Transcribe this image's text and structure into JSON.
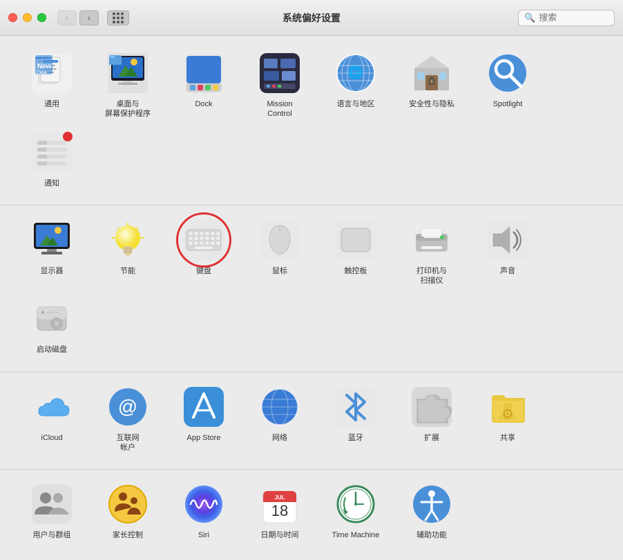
{
  "titlebar": {
    "title": "系统偏好设置",
    "search_placeholder": "搜索"
  },
  "sections": [
    {
      "id": "section1",
      "items": [
        {
          "id": "general",
          "label": "通用",
          "icon": "general"
        },
        {
          "id": "desktop",
          "label": "桌面与\n屏幕保护程序",
          "icon": "desktop"
        },
        {
          "id": "dock",
          "label": "Dock",
          "icon": "dock"
        },
        {
          "id": "mission-control",
          "label": "Mission\nControl",
          "icon": "mission"
        },
        {
          "id": "language",
          "label": "语言与地区",
          "icon": "language"
        },
        {
          "id": "security",
          "label": "安全性与隐私",
          "icon": "security"
        },
        {
          "id": "spotlight",
          "label": "Spotlight",
          "icon": "spotlight"
        },
        {
          "id": "notification",
          "label": "通知",
          "icon": "notification",
          "badge": true
        }
      ]
    },
    {
      "id": "section2",
      "items": [
        {
          "id": "display",
          "label": "显示器",
          "icon": "display"
        },
        {
          "id": "energy",
          "label": "节能",
          "icon": "energy"
        },
        {
          "id": "keyboard",
          "label": "键盘",
          "icon": "keyboard",
          "highlighted": true
        },
        {
          "id": "mouse",
          "label": "鼠标",
          "icon": "mouse"
        },
        {
          "id": "trackpad",
          "label": "触控板",
          "icon": "trackpad"
        },
        {
          "id": "printer",
          "label": "打印机与\n扫描仪",
          "icon": "printer"
        },
        {
          "id": "sound",
          "label": "声音",
          "icon": "sound"
        },
        {
          "id": "startup",
          "label": "启动磁盘",
          "icon": "startup"
        }
      ]
    },
    {
      "id": "section3",
      "items": [
        {
          "id": "icloud",
          "label": "iCloud",
          "icon": "icloud"
        },
        {
          "id": "internet",
          "label": "互联网\n帐户",
          "icon": "internet"
        },
        {
          "id": "appstore",
          "label": "App Store",
          "icon": "appstore"
        },
        {
          "id": "network",
          "label": "网络",
          "icon": "network"
        },
        {
          "id": "bluetooth",
          "label": "蓝牙",
          "icon": "bluetooth"
        },
        {
          "id": "extensions",
          "label": "扩展",
          "icon": "extensions"
        },
        {
          "id": "sharing",
          "label": "共享",
          "icon": "sharing"
        }
      ]
    },
    {
      "id": "section4",
      "items": [
        {
          "id": "users",
          "label": "用户与群组",
          "icon": "users"
        },
        {
          "id": "parental",
          "label": "家长控制",
          "icon": "parental"
        },
        {
          "id": "siri",
          "label": "Siri",
          "icon": "siri"
        },
        {
          "id": "datetime",
          "label": "日期与时间",
          "icon": "datetime"
        },
        {
          "id": "timemachine",
          "label": "Time Machine",
          "icon": "timemachine"
        },
        {
          "id": "accessibility",
          "label": "辅助功能",
          "icon": "accessibility"
        }
      ]
    }
  ]
}
